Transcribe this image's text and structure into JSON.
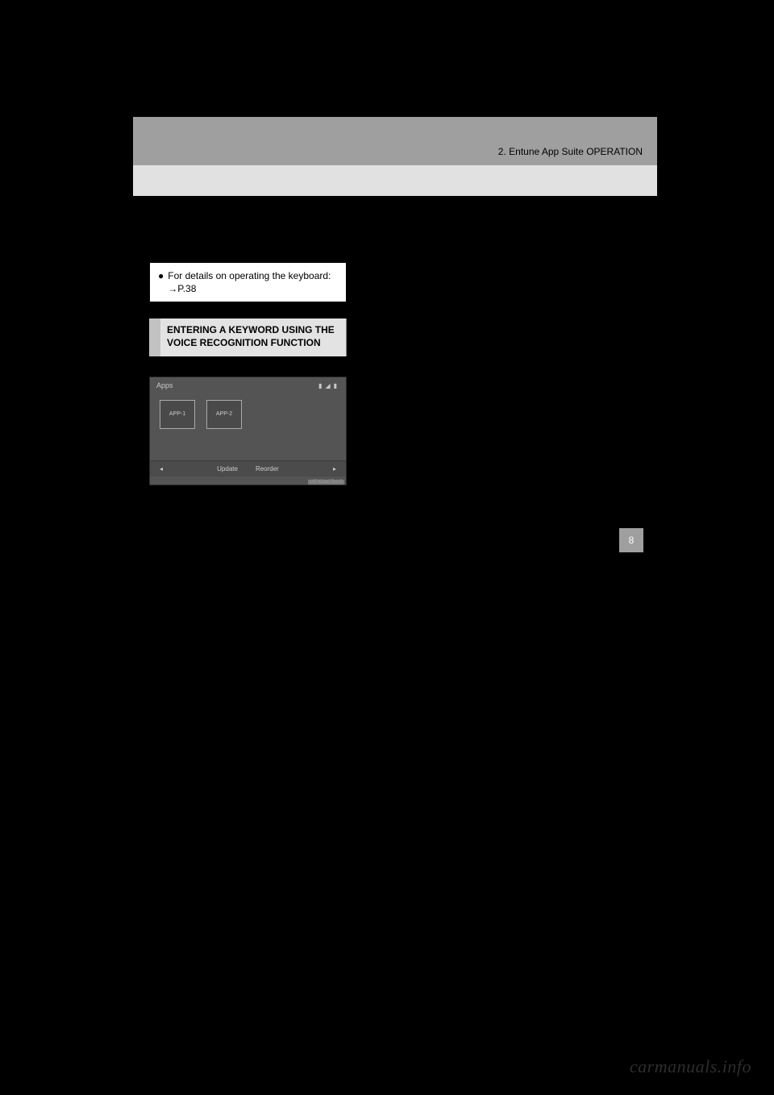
{
  "header": {
    "breadcrumb": "2. Entune App Suite OPERATION"
  },
  "section_tab": "8",
  "info_box": {
    "line1": "For details on operating the keyboard:",
    "line2_prefix": "→",
    "line2": "P.38"
  },
  "heading": "ENTERING A KEYWORD USING THE VOICE RECOGNITION FUNCTION",
  "screenshot": {
    "title": "Apps",
    "status_icons": [
      "▮",
      "◢",
      "▮"
    ],
    "apps": [
      "APP-1",
      "APP-2"
    ],
    "bottom": {
      "left_arrow": "◂",
      "update": "Update",
      "reorder": "Reorder",
      "right_arrow": "▸"
    },
    "code": "UE001eCTeUS"
  },
  "watermark": "carmanuals.info"
}
